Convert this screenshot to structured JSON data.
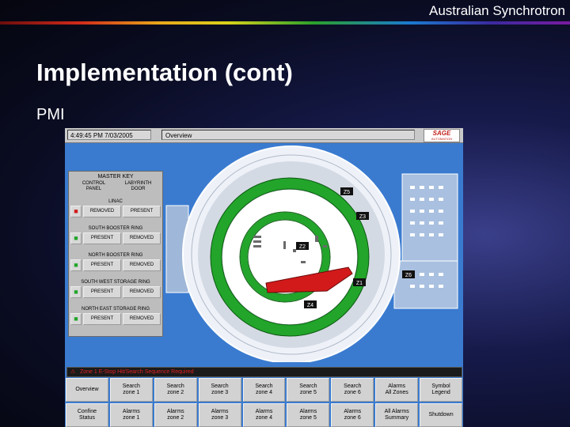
{
  "slide": {
    "brand": "Australian Synchrotron",
    "title": "Implementation (cont)",
    "subtitle": "PMI"
  },
  "hmi": {
    "datetime": "4:49:45 PM 7/03/2005",
    "screen_name": "Overview",
    "logo_main": "SAGE",
    "logo_sub": "AUTOMATION",
    "master_key": {
      "title": "MASTER KEY",
      "col1": "CONTROL\nPANEL",
      "col2": "LABYRINTH\nDOOR"
    },
    "zones": [
      {
        "name": "LINAC",
        "lock_state": "locked",
        "left": "REMOVED",
        "right": "PRESENT"
      },
      {
        "name": "SOUTH BOOSTER RING",
        "lock_state": "unlocked",
        "left": "PRESENT",
        "right": "REMOVED"
      },
      {
        "name": "NORTH BOOSTER RING",
        "lock_state": "unlocked",
        "left": "PRESENT",
        "right": "REMOVED"
      },
      {
        "name": "SOUTH WEST STORAGE RING",
        "lock_state": "unlocked",
        "left": "PRESENT",
        "right": "REMOVED"
      },
      {
        "name": "NORTH EAST STORAGE RING",
        "lock_state": "unlocked",
        "left": "PRESENT",
        "right": "REMOVED"
      }
    ],
    "zone_labels": {
      "z1": "Z1",
      "z2": "Z2",
      "z3": "Z3",
      "z4": "Z4",
      "z5": "Z5",
      "z6": "Z6"
    },
    "message": "Zone 1 E-Stop Hit/Search Sequence Required",
    "nav_buttons": [
      {
        "label": "Overview",
        "id": "overview"
      },
      {
        "label": "Search\nzone 1",
        "id": "search-zone-1"
      },
      {
        "label": "Search\nzone 2",
        "id": "search-zone-2"
      },
      {
        "label": "Search\nzone 3",
        "id": "search-zone-3"
      },
      {
        "label": "Search\nzone 4",
        "id": "search-zone-4"
      },
      {
        "label": "Search\nzone 5",
        "id": "search-zone-5"
      },
      {
        "label": "Search\nzone 6",
        "id": "search-zone-6"
      },
      {
        "label": "Alarms\nAll Zones",
        "id": "alarms-all-zones"
      },
      {
        "label": "Symbol\nLegend",
        "id": "symbol-legend"
      },
      {
        "label": "Confine\nStatus",
        "id": "confine-status"
      },
      {
        "label": "Alarms\nzone 1",
        "id": "alarms-zone-1"
      },
      {
        "label": "Alarms\nzone 2",
        "id": "alarms-zone-2"
      },
      {
        "label": "Alarms\nzone 3",
        "id": "alarms-zone-3"
      },
      {
        "label": "Alarms\nzone 4",
        "id": "alarms-zone-4"
      },
      {
        "label": "Alarms\nzone 5",
        "id": "alarms-zone-5"
      },
      {
        "label": "Alarms\nzone 6",
        "id": "alarms-zone-6"
      },
      {
        "label": "All Alarms\nSummary",
        "id": "all-alarms-summary"
      },
      {
        "label": "Shutdown",
        "id": "shutdown"
      }
    ],
    "colors": {
      "screen_bg": "#3a7bd0",
      "zone_ok": "#22a52a",
      "zone_alarm": "#d21a1a",
      "message_text": "#e02020"
    },
    "icons": {
      "lock_locked": "padlock-red-icon",
      "lock_unlocked": "padlock-green-icon",
      "message": "alarm-icon"
    }
  }
}
